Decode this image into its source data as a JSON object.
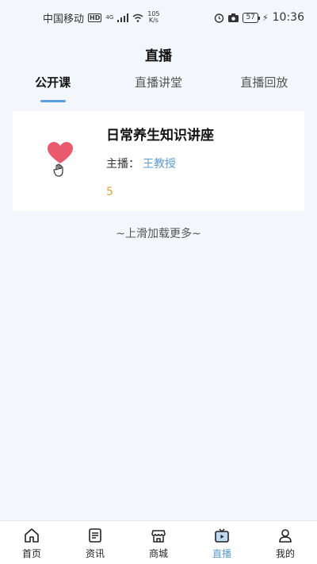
{
  "status_bar": {
    "carrier": "中国移动",
    "hd": "HD",
    "signal": "4G",
    "speed_value": "105",
    "speed_unit": "K/s",
    "battery": "57",
    "time": "10:36"
  },
  "page": {
    "title": "直播"
  },
  "tabs": [
    {
      "label": "公开课",
      "active": true
    },
    {
      "label": "直播讲堂",
      "active": false
    },
    {
      "label": "直播回放",
      "active": false
    }
  ],
  "lecture": {
    "title": "日常养生知识讲座",
    "host_label": "主播：",
    "host_name": "王教授",
    "count": "5",
    "icon": "heart-hand-icon"
  },
  "load_more": "~上滑加载更多~",
  "tab_bar": [
    {
      "label": "首页",
      "icon": "home-icon"
    },
    {
      "label": "资讯",
      "icon": "news-icon"
    },
    {
      "label": "商城",
      "icon": "shop-icon"
    },
    {
      "label": "直播",
      "icon": "live-tv-icon",
      "active": true
    },
    {
      "label": "我的",
      "icon": "user-icon"
    }
  ],
  "colors": {
    "accent": "#5b9bd5",
    "count": "#e6a23c",
    "heart": "#e95a6f"
  }
}
